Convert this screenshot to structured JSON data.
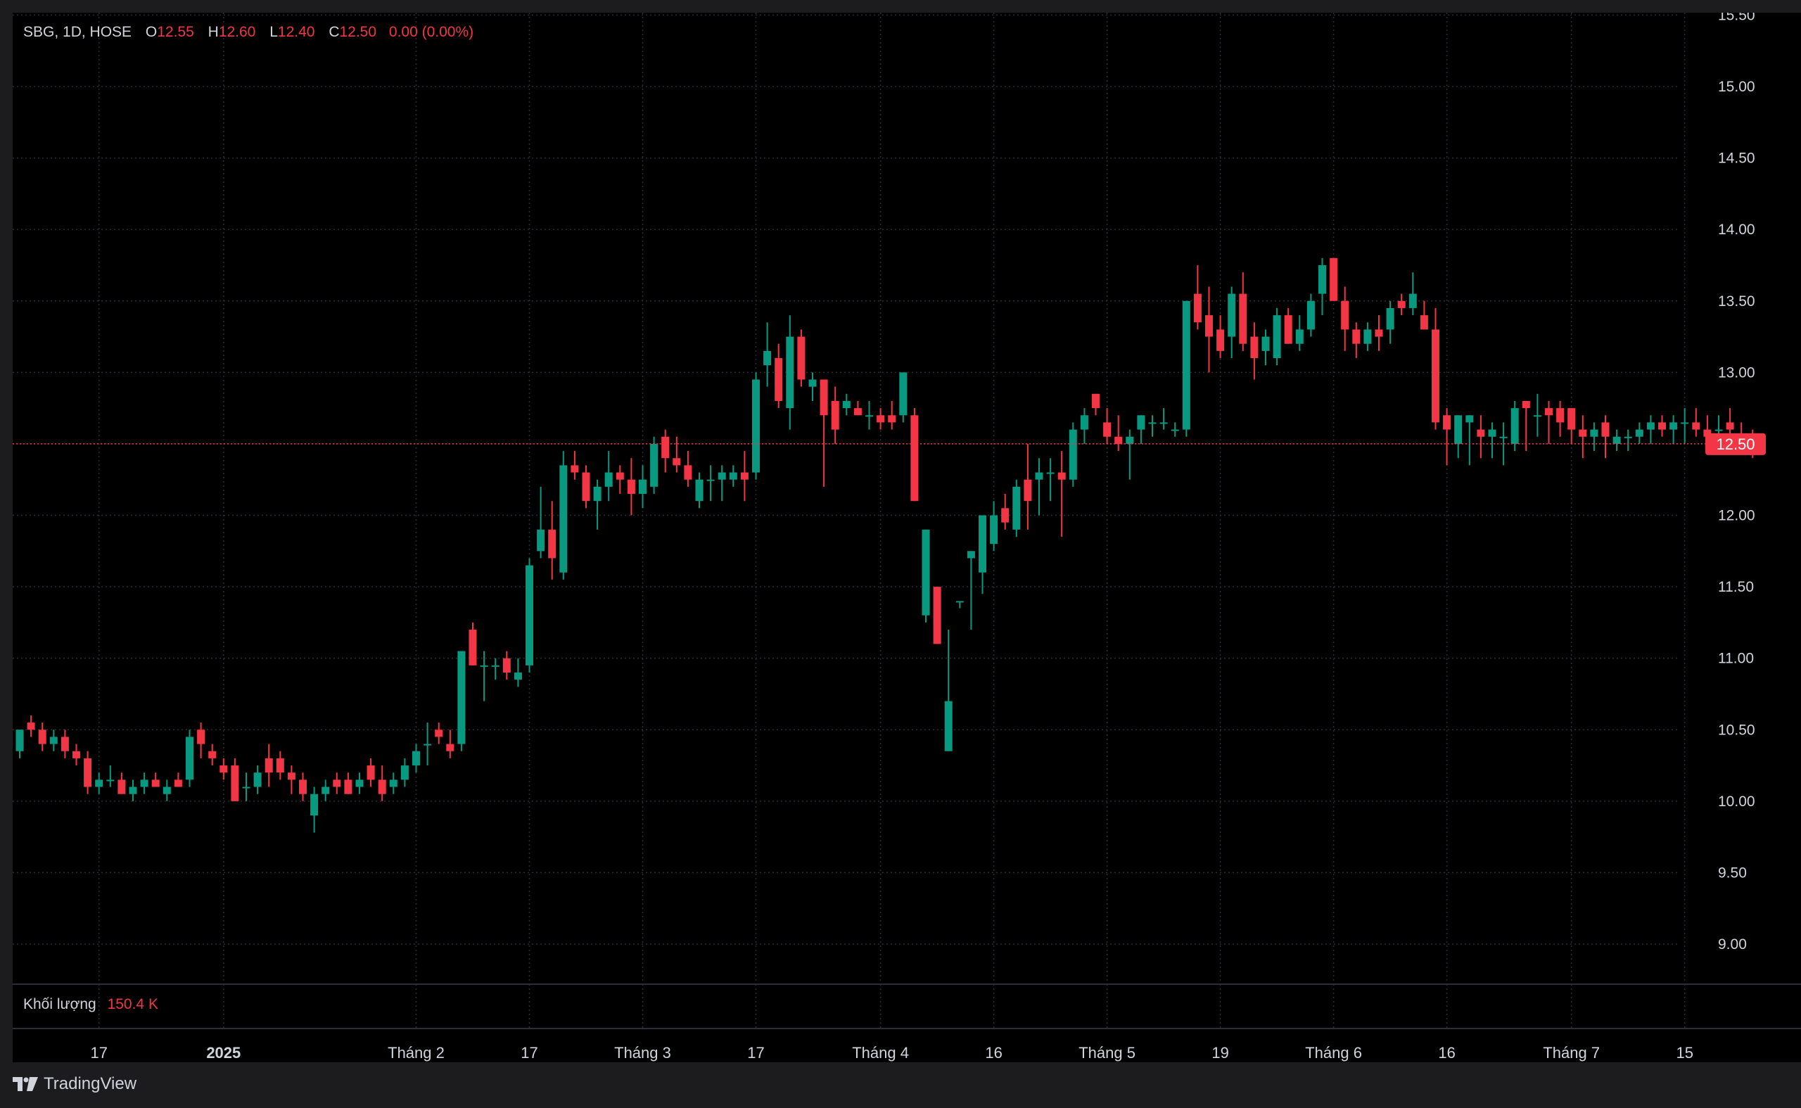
{
  "legend": {
    "symbol": "SBG, 1D, HOSE",
    "o_label": "O",
    "o": "12.55",
    "h_label": "H",
    "h": "12.60",
    "l_label": "L",
    "l": "12.40",
    "c_label": "C",
    "c": "12.50",
    "change": "0.00 (0.00%)"
  },
  "volume": {
    "label": "Khối lượng",
    "value": "150.4 K"
  },
  "brand": {
    "name": "TradingView",
    "icon": "tradingview-logo-icon"
  },
  "colors": {
    "up": "#089981",
    "down": "#f23645",
    "background": "#000000",
    "grid": "#2a2e39",
    "text": "#d1d4dc"
  },
  "chart_data": {
    "type": "candlestick",
    "symbol": "SBG",
    "interval": "1D",
    "exchange": "HOSE",
    "y_ticks": [
      9.0,
      9.5,
      10.0,
      10.5,
      11.0,
      11.5,
      12.0,
      12.5,
      13.0,
      13.5,
      14.0,
      14.5,
      15.0,
      15.5
    ],
    "y_tick_labels": [
      "9.00",
      "9.50",
      "10.00",
      "10.50",
      "11.00",
      "11.50",
      "12.00",
      "12.50",
      "13.00",
      "13.50",
      "14.00",
      "14.50",
      "15.00",
      "15.50"
    ],
    "ylim": [
      8.7,
      15.6
    ],
    "last_price": 12.5,
    "last_price_label": "12.50",
    "grid": true,
    "x_ticks": [
      {
        "label": "17",
        "bar": 7,
        "bold": false
      },
      {
        "label": "2025",
        "bar": 18,
        "bold": true
      },
      {
        "label": "Tháng 2",
        "bar": 35,
        "bold": false
      },
      {
        "label": "17",
        "bar": 45,
        "bold": false
      },
      {
        "label": "Tháng 3",
        "bar": 55,
        "bold": false
      },
      {
        "label": "17",
        "bar": 65,
        "bold": false
      },
      {
        "label": "Tháng 4",
        "bar": 76,
        "bold": false
      },
      {
        "label": "16",
        "bar": 86,
        "bold": false
      },
      {
        "label": "Tháng 5",
        "bar": 96,
        "bold": false
      },
      {
        "label": "19",
        "bar": 106,
        "bold": false
      },
      {
        "label": "Tháng 6",
        "bar": 116,
        "bold": false
      },
      {
        "label": "16",
        "bar": 126,
        "bold": false
      },
      {
        "label": "Tháng 7",
        "bar": 137,
        "bold": false
      },
      {
        "label": "15",
        "bar": 147,
        "bold": false
      }
    ],
    "bars": [
      [
        10.35,
        10.5,
        10.3,
        10.5
      ],
      [
        10.55,
        10.6,
        10.45,
        10.5
      ],
      [
        10.5,
        10.55,
        10.35,
        10.4
      ],
      [
        10.4,
        10.5,
        10.35,
        10.45
      ],
      [
        10.45,
        10.5,
        10.3,
        10.35
      ],
      [
        10.35,
        10.4,
        10.25,
        10.3
      ],
      [
        10.3,
        10.35,
        10.05,
        10.1
      ],
      [
        10.1,
        10.2,
        10.05,
        10.15
      ],
      [
        10.15,
        10.25,
        10.1,
        10.15
      ],
      [
        10.15,
        10.2,
        10.05,
        10.05
      ],
      [
        10.05,
        10.15,
        10.0,
        10.1
      ],
      [
        10.1,
        10.2,
        10.05,
        10.15
      ],
      [
        10.15,
        10.2,
        10.1,
        10.1
      ],
      [
        10.05,
        10.15,
        10.0,
        10.1
      ],
      [
        10.15,
        10.2,
        10.1,
        10.1
      ],
      [
        10.15,
        10.5,
        10.1,
        10.45
      ],
      [
        10.5,
        10.55,
        10.3,
        10.4
      ],
      [
        10.35,
        10.4,
        10.25,
        10.3
      ],
      [
        10.25,
        10.3,
        10.15,
        10.2
      ],
      [
        10.25,
        10.3,
        10.0,
        10.0
      ],
      [
        10.1,
        10.2,
        10.0,
        10.1
      ],
      [
        10.1,
        10.25,
        10.05,
        10.2
      ],
      [
        10.3,
        10.4,
        10.1,
        10.2
      ],
      [
        10.3,
        10.35,
        10.15,
        10.2
      ],
      [
        10.2,
        10.25,
        10.05,
        10.15
      ],
      [
        10.15,
        10.2,
        10.0,
        10.05
      ],
      [
        9.9,
        10.1,
        9.78,
        10.05
      ],
      [
        10.05,
        10.15,
        10.0,
        10.1
      ],
      [
        10.15,
        10.2,
        10.05,
        10.1
      ],
      [
        10.15,
        10.2,
        10.05,
        10.05
      ],
      [
        10.1,
        10.2,
        10.05,
        10.15
      ],
      [
        10.25,
        10.3,
        10.1,
        10.15
      ],
      [
        10.15,
        10.25,
        10.0,
        10.05
      ],
      [
        10.1,
        10.2,
        10.05,
        10.15
      ],
      [
        10.15,
        10.3,
        10.1,
        10.25
      ],
      [
        10.25,
        10.4,
        10.2,
        10.35
      ],
      [
        10.4,
        10.55,
        10.25,
        10.4
      ],
      [
        10.5,
        10.55,
        10.4,
        10.45
      ],
      [
        10.4,
        10.5,
        10.3,
        10.35
      ],
      [
        10.4,
        11.05,
        10.35,
        11.05
      ],
      [
        11.2,
        11.25,
        10.95,
        10.95
      ],
      [
        10.95,
        11.05,
        10.7,
        10.95
      ],
      [
        10.95,
        11.0,
        10.85,
        10.95
      ],
      [
        11.0,
        11.05,
        10.85,
        10.9
      ],
      [
        10.85,
        11.0,
        10.8,
        10.9
      ],
      [
        10.95,
        11.7,
        10.9,
        11.65
      ],
      [
        11.75,
        12.2,
        11.7,
        11.9
      ],
      [
        11.9,
        12.1,
        11.55,
        11.7
      ],
      [
        11.6,
        12.45,
        11.55,
        12.35
      ],
      [
        12.35,
        12.45,
        12.25,
        12.3
      ],
      [
        12.3,
        12.35,
        12.05,
        12.1
      ],
      [
        12.1,
        12.25,
        11.9,
        12.2
      ],
      [
        12.2,
        12.45,
        12.1,
        12.3
      ],
      [
        12.3,
        12.35,
        12.15,
        12.25
      ],
      [
        12.25,
        12.4,
        12.0,
        12.15
      ],
      [
        12.15,
        12.35,
        12.05,
        12.25
      ],
      [
        12.2,
        12.55,
        12.15,
        12.5
      ],
      [
        12.55,
        12.6,
        12.3,
        12.4
      ],
      [
        12.4,
        12.55,
        12.3,
        12.35
      ],
      [
        12.35,
        12.45,
        12.2,
        12.25
      ],
      [
        12.1,
        12.3,
        12.05,
        12.25
      ],
      [
        12.25,
        12.35,
        12.1,
        12.25
      ],
      [
        12.25,
        12.35,
        12.1,
        12.3
      ],
      [
        12.25,
        12.35,
        12.2,
        12.3
      ],
      [
        12.3,
        12.45,
        12.1,
        12.25
      ],
      [
        12.3,
        13.0,
        12.25,
        12.95
      ],
      [
        13.05,
        13.35,
        12.9,
        13.15
      ],
      [
        13.1,
        13.2,
        12.75,
        12.8
      ],
      [
        12.75,
        13.4,
        12.6,
        13.25
      ],
      [
        13.25,
        13.3,
        12.9,
        12.95
      ],
      [
        12.9,
        13.0,
        12.8,
        12.95
      ],
      [
        12.95,
        12.95,
        12.2,
        12.7
      ],
      [
        12.8,
        12.9,
        12.5,
        12.6
      ],
      [
        12.75,
        12.85,
        12.7,
        12.8
      ],
      [
        12.75,
        12.8,
        12.7,
        12.7
      ],
      [
        12.7,
        12.8,
        12.6,
        12.7
      ],
      [
        12.7,
        12.75,
        12.6,
        12.65
      ],
      [
        12.7,
        12.8,
        12.6,
        12.65
      ],
      [
        12.7,
        13.0,
        12.65,
        13.0
      ],
      [
        12.7,
        12.75,
        12.1,
        12.1
      ],
      [
        11.3,
        11.9,
        11.25,
        11.9
      ],
      [
        11.5,
        11.5,
        11.1,
        11.1
      ],
      [
        10.35,
        11.2,
        10.35,
        10.7
      ],
      [
        11.4,
        11.4,
        11.35,
        11.4
      ],
      [
        11.7,
        11.75,
        11.2,
        11.75
      ],
      [
        11.6,
        12.0,
        11.45,
        12.0
      ],
      [
        11.8,
        12.1,
        11.75,
        12.0
      ],
      [
        12.05,
        12.15,
        11.9,
        11.95
      ],
      [
        11.9,
        12.25,
        11.85,
        12.2
      ],
      [
        12.25,
        12.5,
        11.9,
        12.1
      ],
      [
        12.25,
        12.4,
        12.0,
        12.3
      ],
      [
        12.3,
        12.4,
        12.1,
        12.3
      ],
      [
        12.3,
        12.45,
        11.85,
        12.25
      ],
      [
        12.25,
        12.65,
        12.2,
        12.6
      ],
      [
        12.6,
        12.75,
        12.5,
        12.7
      ],
      [
        12.85,
        12.85,
        12.7,
        12.75
      ],
      [
        12.65,
        12.75,
        12.5,
        12.55
      ],
      [
        12.55,
        12.7,
        12.45,
        12.5
      ],
      [
        12.5,
        12.6,
        12.25,
        12.55
      ],
      [
        12.6,
        12.7,
        12.5,
        12.7
      ],
      [
        12.65,
        12.7,
        12.55,
        12.65
      ],
      [
        12.65,
        12.75,
        12.6,
        12.65
      ],
      [
        12.6,
        12.65,
        12.55,
        12.6
      ],
      [
        12.6,
        13.5,
        12.55,
        13.5
      ],
      [
        13.55,
        13.75,
        13.3,
        13.35
      ],
      [
        13.4,
        13.6,
        13.0,
        13.25
      ],
      [
        13.3,
        13.4,
        13.1,
        13.15
      ],
      [
        13.25,
        13.6,
        13.1,
        13.55
      ],
      [
        13.55,
        13.7,
        13.15,
        13.2
      ],
      [
        13.25,
        13.35,
        12.95,
        13.1
      ],
      [
        13.15,
        13.3,
        13.05,
        13.25
      ],
      [
        13.1,
        13.45,
        13.05,
        13.4
      ],
      [
        13.4,
        13.45,
        13.2,
        13.2
      ],
      [
        13.2,
        13.4,
        13.15,
        13.3
      ],
      [
        13.3,
        13.55,
        13.25,
        13.5
      ],
      [
        13.55,
        13.8,
        13.4,
        13.75
      ],
      [
        13.8,
        13.8,
        13.5,
        13.5
      ],
      [
        13.5,
        13.6,
        13.15,
        13.3
      ],
      [
        13.3,
        13.35,
        13.1,
        13.2
      ],
      [
        13.2,
        13.35,
        13.15,
        13.3
      ],
      [
        13.3,
        13.4,
        13.15,
        13.25
      ],
      [
        13.3,
        13.5,
        13.2,
        13.45
      ],
      [
        13.5,
        13.55,
        13.4,
        13.45
      ],
      [
        13.45,
        13.7,
        13.4,
        13.55
      ],
      [
        13.4,
        13.5,
        13.3,
        13.3
      ],
      [
        13.3,
        13.45,
        12.6,
        12.65
      ],
      [
        12.7,
        12.75,
        12.35,
        12.6
      ],
      [
        12.5,
        12.7,
        12.4,
        12.7
      ],
      [
        12.65,
        12.7,
        12.35,
        12.7
      ],
      [
        12.6,
        12.7,
        12.4,
        12.55
      ],
      [
        12.55,
        12.65,
        12.4,
        12.6
      ],
      [
        12.55,
        12.65,
        12.35,
        12.55
      ],
      [
        12.5,
        12.8,
        12.45,
        12.75
      ],
      [
        12.8,
        12.8,
        12.45,
        12.75
      ],
      [
        12.7,
        12.85,
        12.55,
        12.7
      ],
      [
        12.75,
        12.8,
        12.5,
        12.7
      ],
      [
        12.75,
        12.8,
        12.55,
        12.65
      ],
      [
        12.75,
        12.75,
        12.5,
        12.6
      ],
      [
        12.6,
        12.7,
        12.4,
        12.55
      ],
      [
        12.55,
        12.65,
        12.45,
        12.6
      ],
      [
        12.65,
        12.7,
        12.4,
        12.55
      ],
      [
        12.5,
        12.6,
        12.45,
        12.55
      ],
      [
        12.55,
        12.6,
        12.45,
        12.55
      ],
      [
        12.55,
        12.65,
        12.5,
        12.6
      ],
      [
        12.6,
        12.7,
        12.5,
        12.65
      ],
      [
        12.65,
        12.7,
        12.55,
        12.6
      ],
      [
        12.6,
        12.7,
        12.5,
        12.65
      ],
      [
        12.65,
        12.75,
        12.5,
        12.65
      ],
      [
        12.65,
        12.75,
        12.55,
        12.6
      ],
      [
        12.6,
        12.7,
        12.45,
        12.55
      ],
      [
        12.6,
        12.7,
        12.5,
        12.6
      ],
      [
        12.65,
        12.75,
        12.55,
        12.6
      ],
      [
        12.55,
        12.65,
        12.45,
        12.5
      ],
      [
        12.55,
        12.6,
        12.4,
        12.5
      ]
    ]
  }
}
